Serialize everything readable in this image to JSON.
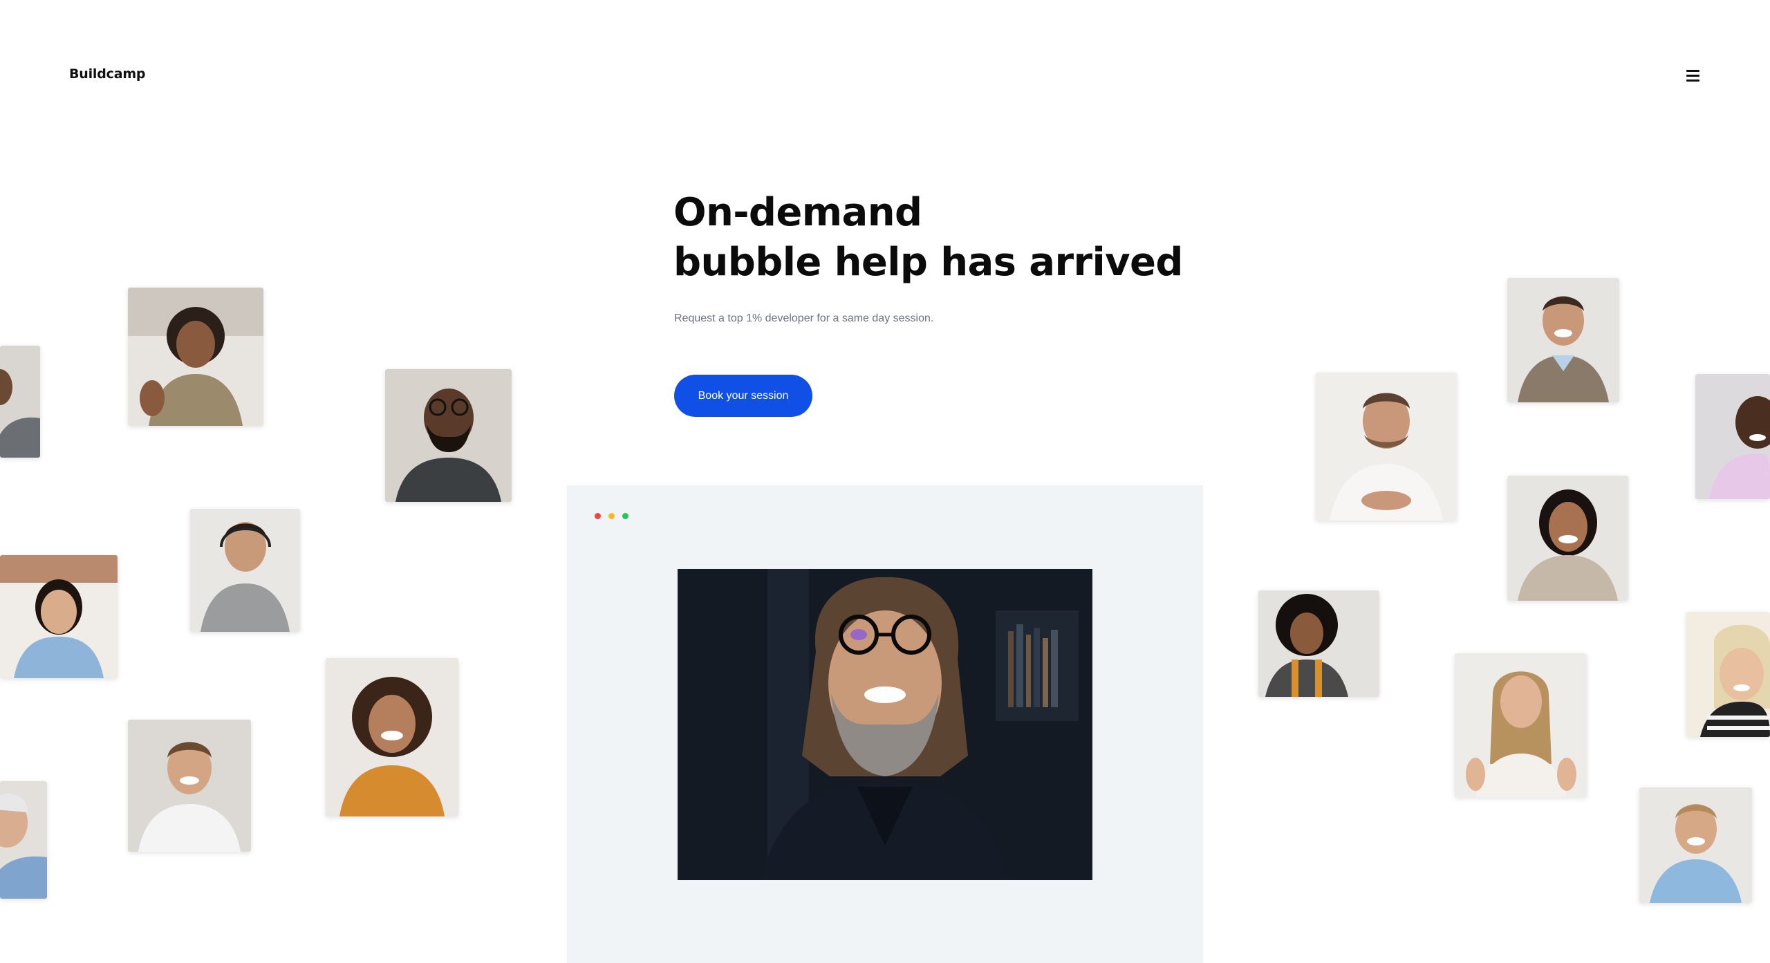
{
  "brand": {
    "name": "Buildcamp"
  },
  "nav": {
    "menu_icon": "hamburger-menu-icon"
  },
  "hero": {
    "headline_line1": "On-demand",
    "headline_line2": "bubble help has arrived",
    "subtitle": "Request a top 1% developer for a same day session.",
    "cta_label": "Book your session"
  },
  "browser": {
    "window_dots": [
      "#ef4444",
      "#f5b921",
      "#22c55e"
    ]
  },
  "colors": {
    "accent": "#1150e6",
    "heading": "#0b0b0b",
    "muted_text": "#6b7280",
    "browser_bg": "#f1f4f7"
  }
}
